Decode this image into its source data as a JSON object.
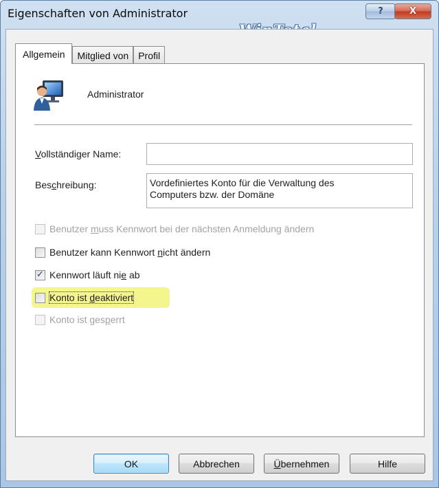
{
  "window": {
    "title": "Eigenschaften von Administrator",
    "watermark": "WinTotal",
    "help_glyph": "?",
    "close_glyph": "X"
  },
  "tabs": [
    {
      "label": "Allgemein",
      "active": true
    },
    {
      "label": "Mitglied von",
      "active": false
    },
    {
      "label": "Profil",
      "active": false
    }
  ],
  "user": {
    "icon": "user-account-icon",
    "name": "Administrator"
  },
  "fields": {
    "full_name": {
      "label_before": "V",
      "label_rest": "ollständiger Name:",
      "value": ""
    },
    "description": {
      "label_pre": "Bes",
      "label_u": "c",
      "label_post": "hreibung:",
      "line1": "Vordefiniertes Konto für die Verwaltung des",
      "line2": "Computers bzw. der Domäne"
    }
  },
  "checkboxes": [
    {
      "pre": "Benutzer ",
      "u": "m",
      "post": "uss Kennwort bei der nächsten Anmeldung ändern",
      "checked": false,
      "enabled": false
    },
    {
      "pre": "Benutzer kann Kennwort ",
      "u": "n",
      "post": "icht ändern",
      "checked": false,
      "enabled": true
    },
    {
      "pre": "Kennwort läuft ni",
      "u": "e",
      "post": " ab",
      "checked": true,
      "enabled": true
    },
    {
      "pre": "Konto ist ",
      "u": "d",
      "post": "eaktiviert",
      "checked": false,
      "enabled": true,
      "highlighted": true,
      "focused": true
    },
    {
      "pre": "Konto ist ges",
      "u": "p",
      "post": "errt",
      "checked": false,
      "enabled": false
    }
  ],
  "buttons": {
    "ok": "OK",
    "cancel": "Abbrechen",
    "apply_u": "Ü",
    "apply_rest": "bernehmen",
    "help": "Hilfe"
  },
  "colors": {
    "highlight": "#f3f37a",
    "title_bar": "#b9d1ea",
    "close_button": "#c0391f"
  }
}
